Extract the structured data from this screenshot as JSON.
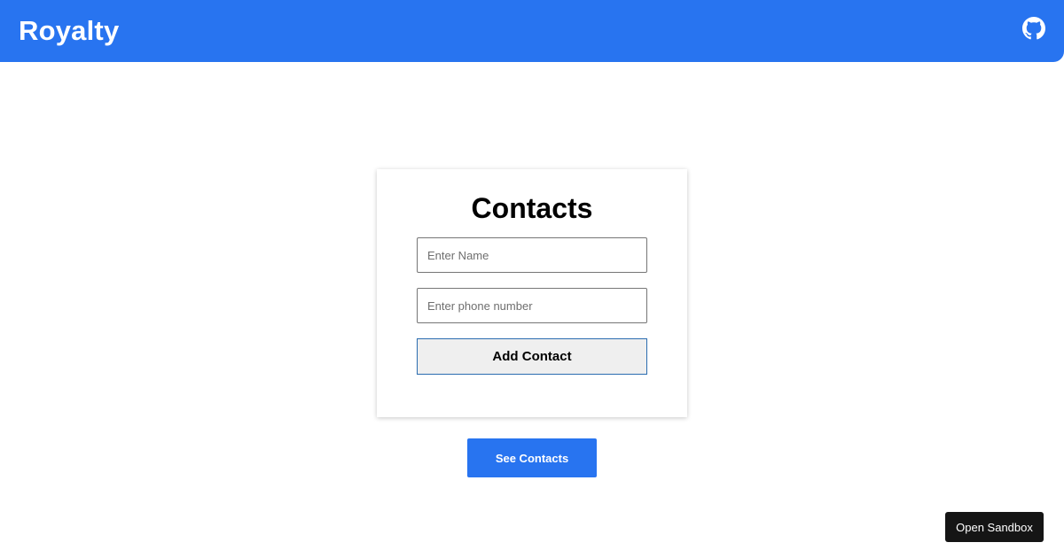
{
  "header": {
    "brand": "Royalty",
    "github_icon": "github-icon",
    "background_color": "#2874f0"
  },
  "form": {
    "title": "Contacts",
    "name_placeholder": "Enter Name",
    "name_value": "",
    "phone_placeholder": "Enter phone number",
    "phone_value": "",
    "add_label": "Add Contact"
  },
  "actions": {
    "see_contacts_label": "See Contacts",
    "accent_color": "#2874f0"
  },
  "sandbox": {
    "label": "Open Sandbox"
  }
}
